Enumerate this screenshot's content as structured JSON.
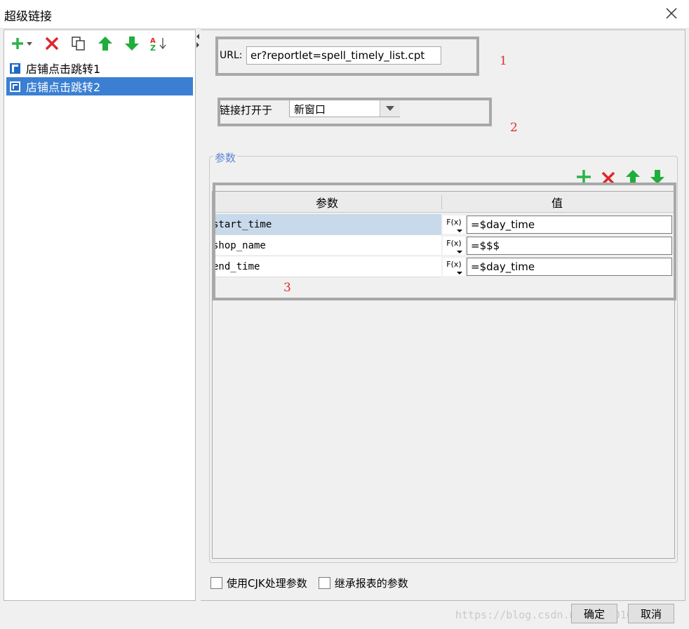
{
  "window": {
    "title": "超级链接"
  },
  "links": {
    "items": [
      {
        "label": "店铺点击跳转1",
        "selected": false
      },
      {
        "label": "店铺点击跳转2",
        "selected": true
      }
    ]
  },
  "url": {
    "label": "URL:",
    "value": "er?reportlet=spell_timely_list.cpt"
  },
  "open_in": {
    "label": "链接打开于",
    "selected": "新窗口"
  },
  "params": {
    "group_title": "参数",
    "col_name": "参数",
    "col_value": "值",
    "fx_label": "F(x)",
    "rows": [
      {
        "name": "start_time",
        "value": "=$day_time"
      },
      {
        "name": "shop_name",
        "value": "=$$$"
      },
      {
        "name": "end_time",
        "value": "=$day_time"
      }
    ]
  },
  "options": {
    "use_cjk": "使用CJK处理参数",
    "inherit": "继承报表的参数"
  },
  "buttons": {
    "ok": "确定",
    "cancel": "取消"
  },
  "annotations": [
    "1",
    "2",
    "3"
  ],
  "watermark": "https://blog.csdn.net/u010168173"
}
